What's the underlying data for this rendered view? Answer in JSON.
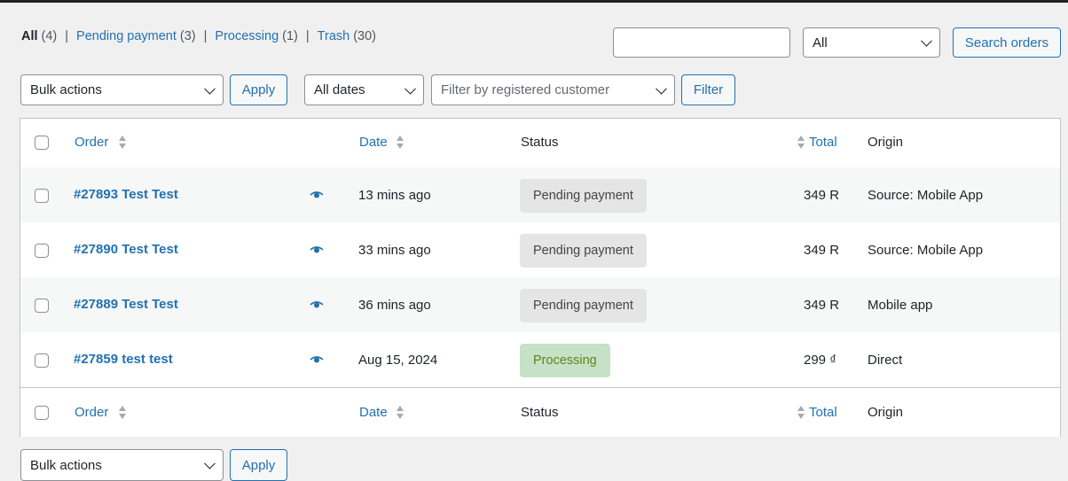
{
  "views": [
    {
      "label": "All",
      "count": "(4)"
    },
    {
      "label": "Pending payment",
      "count": "(3)"
    },
    {
      "label": "Processing",
      "count": "(1)"
    },
    {
      "label": "Trash",
      "count": "(30)"
    }
  ],
  "search": {
    "value": "",
    "status_select": "All",
    "button": "Search orders"
  },
  "top_nav": {
    "bulk_actions": "Bulk actions",
    "apply": "Apply",
    "dates": "All dates",
    "customer_placeholder": "Filter by registered customer",
    "filter": "Filter"
  },
  "columns": {
    "order": "Order",
    "date": "Date",
    "status": "Status",
    "total": "Total",
    "origin": "Origin"
  },
  "orders": [
    {
      "title": "#27893 Test Test",
      "date": "13 mins ago",
      "status": "Pending payment",
      "total": "349 R",
      "origin": "Source: Mobile App"
    },
    {
      "title": "#27890 Test Test",
      "date": "33 mins ago",
      "status": "Pending payment",
      "total": "349 R",
      "origin": "Source: Mobile App"
    },
    {
      "title": "#27889 Test Test",
      "date": "36 mins ago",
      "status": "Pending payment",
      "total": "349 R",
      "origin": "Mobile app"
    },
    {
      "title": "#27859 test test",
      "date": "Aug 15, 2024",
      "status": "Processing",
      "total": "299 ₫",
      "origin": "Direct"
    }
  ],
  "bottom_nav": {
    "bulk_actions": "Bulk actions",
    "apply": "Apply"
  },
  "colors": {
    "link": "#2271b1",
    "pending_bg": "#e5e5e5",
    "processing_bg": "#c6e1c6",
    "processing_text": "#5b841b"
  }
}
